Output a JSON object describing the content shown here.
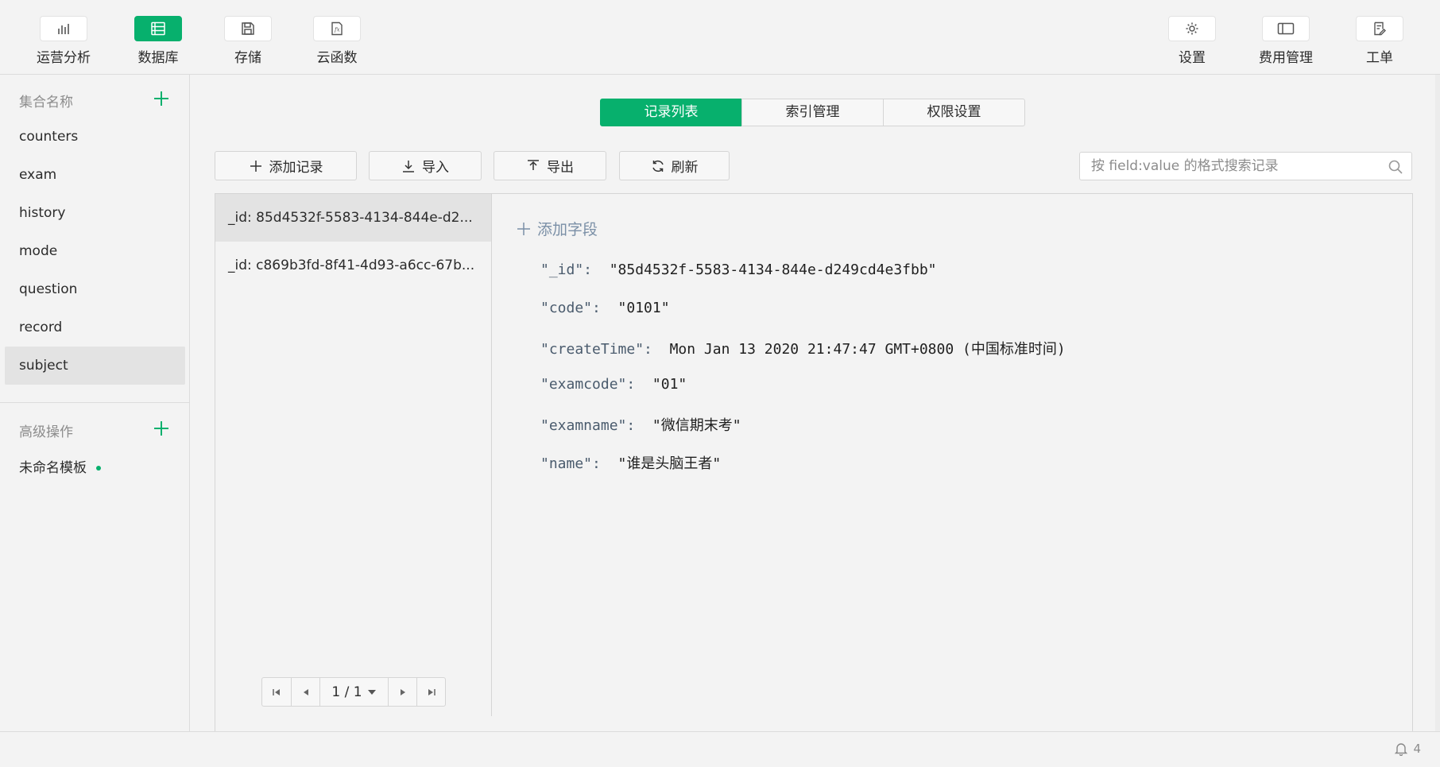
{
  "toolbar": {
    "left": [
      {
        "label": "运营分析",
        "icon": "bar-chart-icon",
        "active": false
      },
      {
        "label": "数据库",
        "icon": "database-icon",
        "active": true
      },
      {
        "label": "存储",
        "icon": "save-icon",
        "active": false
      },
      {
        "label": "云函数",
        "icon": "function-icon",
        "active": false
      }
    ],
    "right": [
      {
        "label": "设置",
        "icon": "gear-icon"
      },
      {
        "label": "费用管理",
        "icon": "billing-icon"
      },
      {
        "label": "工单",
        "icon": "ticket-icon"
      }
    ]
  },
  "sidebar": {
    "collections_heading": "集合名称",
    "collections": [
      "counters",
      "exam",
      "history",
      "mode",
      "question",
      "record",
      "subject"
    ],
    "selected_collection": "subject",
    "advanced_heading": "高级操作",
    "template_item": "未命名模板"
  },
  "tabs": [
    {
      "label": "记录列表",
      "active": true
    },
    {
      "label": "索引管理",
      "active": false
    },
    {
      "label": "权限设置",
      "active": false
    }
  ],
  "actions": {
    "add_record": "添加记录",
    "import": "导入",
    "export": "导出",
    "refresh": "刷新"
  },
  "search": {
    "placeholder": "按 field:value 的格式搜索记录",
    "value": ""
  },
  "records": [
    "_id: 85d4532f-5583-4134-844e-d2...",
    "_id: c869b3fd-8f41-4d93-a6cc-67b..."
  ],
  "pagination": {
    "page_label": "1 / 1"
  },
  "detail": {
    "add_field": "添加字段",
    "fields": [
      {
        "key": "\"_id\":",
        "value": "\"85d4532f-5583-4134-844e-d249cd4e3fbb\""
      },
      {
        "key": "\"code\":",
        "value": "\"0101\""
      },
      {
        "key": "\"createTime\":",
        "value": "Mon Jan 13 2020 21:47:47 GMT+0800 (中国标准时间)"
      },
      {
        "key": "\"examcode\":",
        "value": "\"01\""
      },
      {
        "key": "\"examname\":",
        "value": "\"微信期末考\""
      },
      {
        "key": "\"name\":",
        "value": "\"谁是头脑王者\""
      }
    ]
  },
  "status": {
    "notification_count": "4"
  },
  "colors": {
    "accent": "#07b06d"
  }
}
